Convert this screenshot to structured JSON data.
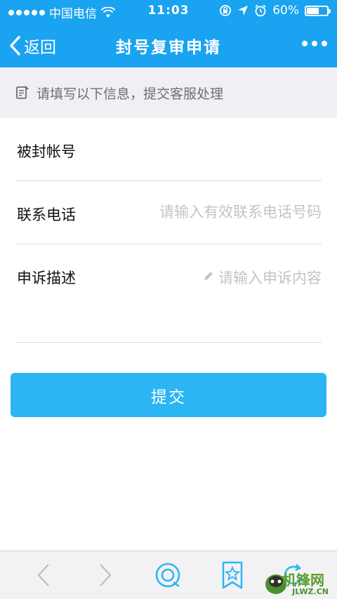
{
  "status_bar": {
    "carrier": "中国电信",
    "time": "11:03",
    "battery": "60%",
    "battery_level": 0.6
  },
  "nav": {
    "back_label": "返回",
    "title": "封号复审申请"
  },
  "hint": {
    "text": "请填写以下信息，提交客服处理"
  },
  "form": {
    "account_label": "被封帐号",
    "account_value": "",
    "phone_label": "联系电话",
    "phone_placeholder": "请输入有效联系电话号码",
    "desc_label": "申诉描述",
    "desc_placeholder": "请输入申诉内容"
  },
  "submit_label": "提交",
  "watermark": {
    "brand": "机锋网",
    "domain": "JLWZ.CN"
  },
  "colors": {
    "nav_bg": "#1aa3f0",
    "button_bg": "#2bb5f2",
    "hint_bg": "#efeff4"
  }
}
